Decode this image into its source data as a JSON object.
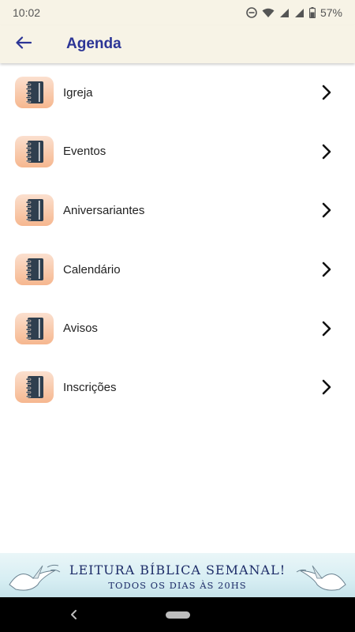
{
  "status_bar": {
    "time": "10:02",
    "battery": "57%",
    "icons": [
      "do-not-disturb-icon",
      "wifi-icon",
      "signal-icon",
      "signal-icon",
      "battery-icon"
    ]
  },
  "app_bar": {
    "title": "Agenda",
    "back_icon": "arrow-left-icon",
    "title_color": "#2c3596",
    "background": "#f7f3e6"
  },
  "agenda_items": [
    {
      "label": "Igreja",
      "icon": "notebook-icon"
    },
    {
      "label": "Eventos",
      "icon": "notebook-icon"
    },
    {
      "label": "Aniversariantes",
      "icon": "notebook-icon"
    },
    {
      "label": "Calendário",
      "icon": "notebook-icon"
    },
    {
      "label": "Avisos",
      "icon": "notebook-icon"
    },
    {
      "label": "Inscrições",
      "icon": "notebook-icon"
    }
  ],
  "banner": {
    "line1": "LEITURA BÍBLICA SEMANAL!",
    "line2": "TODOS OS DIAS ÀS 20HS"
  },
  "nav_bar": {
    "back_icon": "nav-back-icon",
    "home_icon": "nav-home-pill"
  }
}
